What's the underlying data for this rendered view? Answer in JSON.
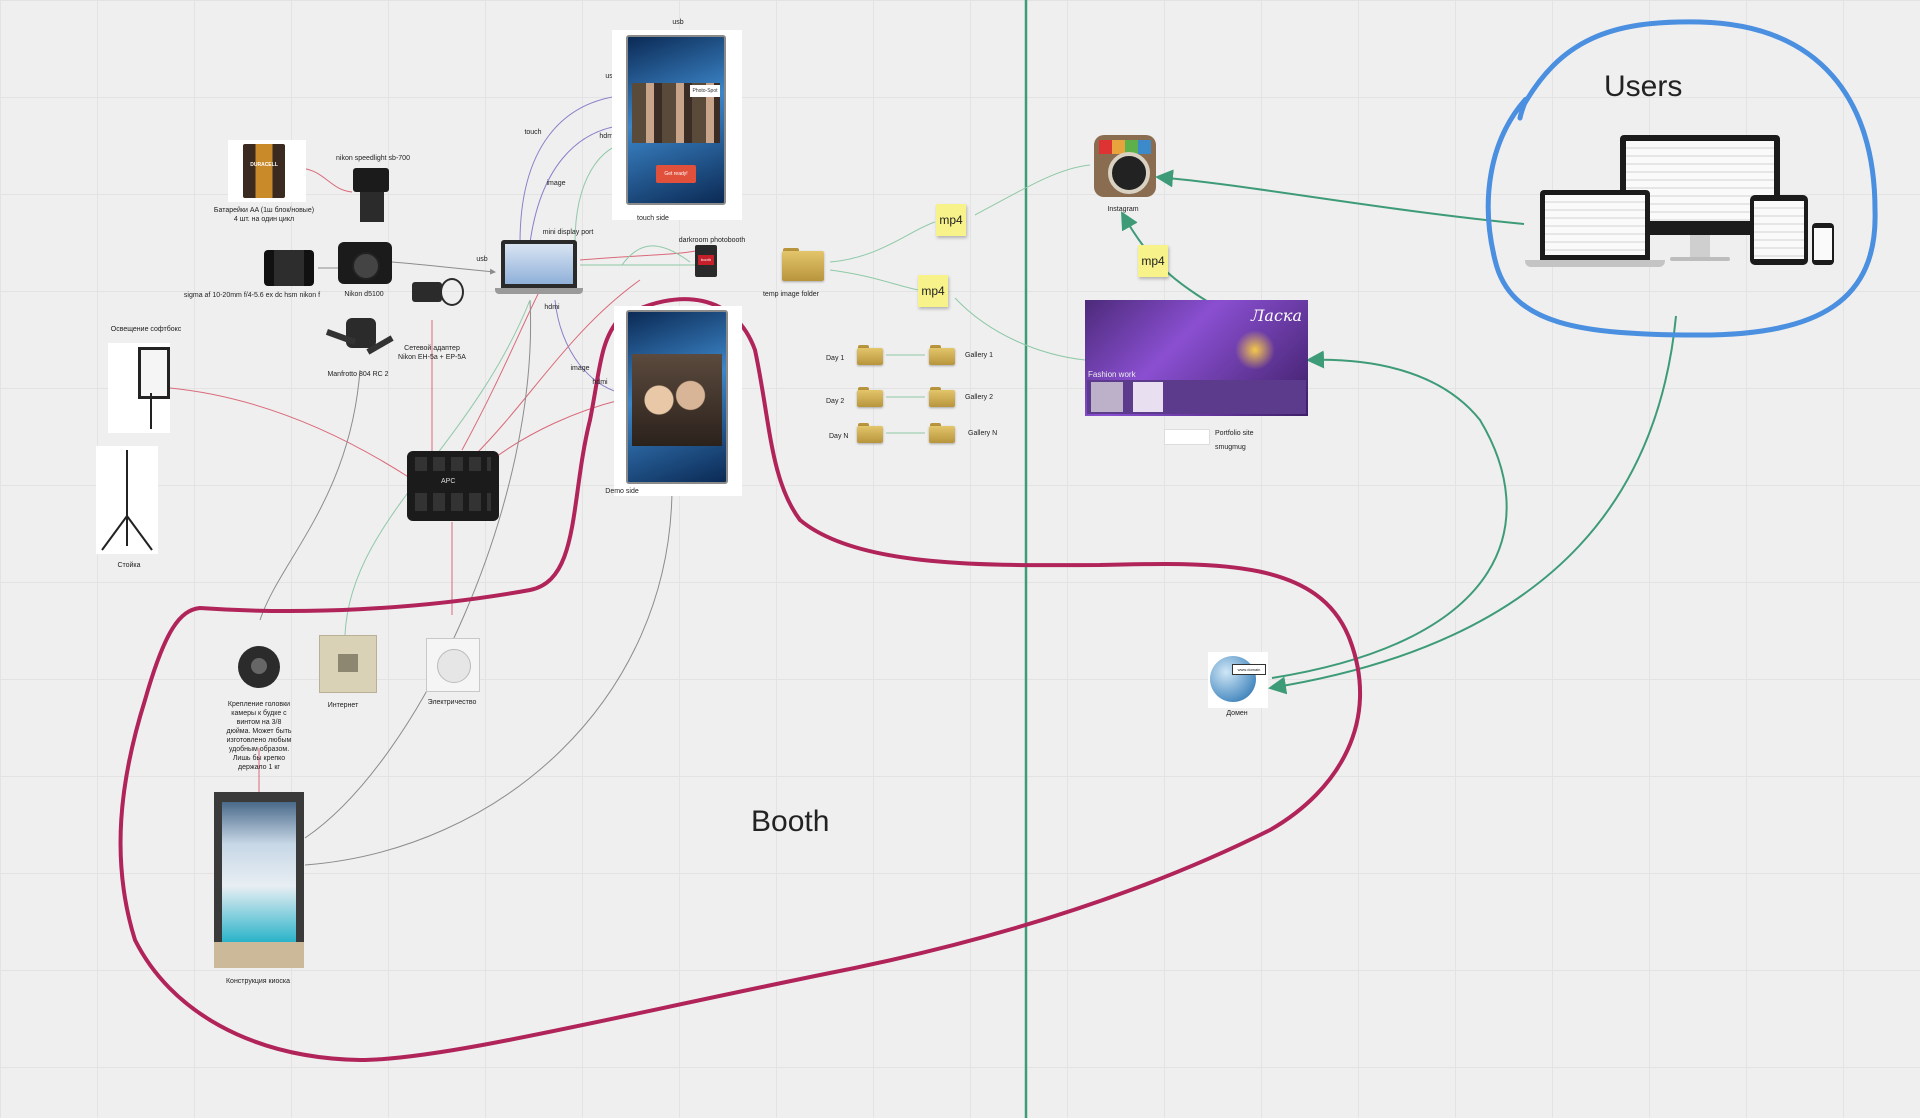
{
  "boundary": {
    "label": ""
  },
  "areas": {
    "users": "Users",
    "booth": "Booth"
  },
  "stickies": {
    "mp4_a": "mp4",
    "mp4_b": "mp4",
    "mp4_c": "mp4"
  },
  "items": {
    "usb_top": "usb",
    "touch_side": "touch side",
    "demo_side": "Demo side",
    "mini_display_port": "mini display port",
    "darkroom": "darkroom photobooth",
    "temp_folder": "temp image folder",
    "batteries": "Батарейки AA (1ш блок/новые)\n4 шт. на один цикл",
    "speedlight": "nikon speedlight sb-700",
    "lens": "sigma af 10-20mm f/4-5.6 ex dc hsm nikon f",
    "camera": "Nikon d5100",
    "adapter": "Сетевой адаптер\nNikon EH-5a + EP-5A",
    "tripod_head": "Manfrotto 804 RC 2",
    "softbox": "Освещение софтбокс",
    "stand": "Стойка",
    "mount": "Крепление головки камеры к будке с винтом на 3/8 дюйма. Может быть изготовлено любым удобным образом. Лишь бы крепко держало 1 кг",
    "internet": "Интернет",
    "power": "Электричество",
    "kiosk": "Конструкция киоска",
    "instagram": "Instagram",
    "portfolio": "Portfolio site\nsmugmug",
    "domain": "Домен",
    "day1": "Day 1",
    "day2": "Day 2",
    "dayn": "Day N",
    "gallery1": "Gallery 1",
    "gallery2": "Gallery 2",
    "galleryn": "Gallery N",
    "portfolio_title": "Ласка",
    "portfolio_sub": "Fashion work",
    "battery_brand": "DURACELL",
    "ups_brand": "APC",
    "booth_btn": "Get ready!",
    "strip_badge": "Photo-Spot",
    "darkroom_tag": "booth",
    "domain_tag": "www.domain"
  },
  "edge_labels": {
    "usb_a": "usb",
    "touch": "touch",
    "hdmi_a": "hdmi",
    "image_a": "image",
    "usb_b": "usb",
    "hdmi_b": "hdmi",
    "image_b": "image",
    "hdmi_c": "hdmi"
  },
  "colors": {
    "users_loop": "#4a8fe0",
    "booth_loop": "#b0245a",
    "divider": "#3d9b77",
    "teal_arrow": "#3d9b77",
    "red_wire": "#d96a7a",
    "grey_wire": "#8c8c8c",
    "purple_wire": "#8c7fc9",
    "green_wire": "#8fc9a7",
    "sticky": "#f7f28a"
  }
}
